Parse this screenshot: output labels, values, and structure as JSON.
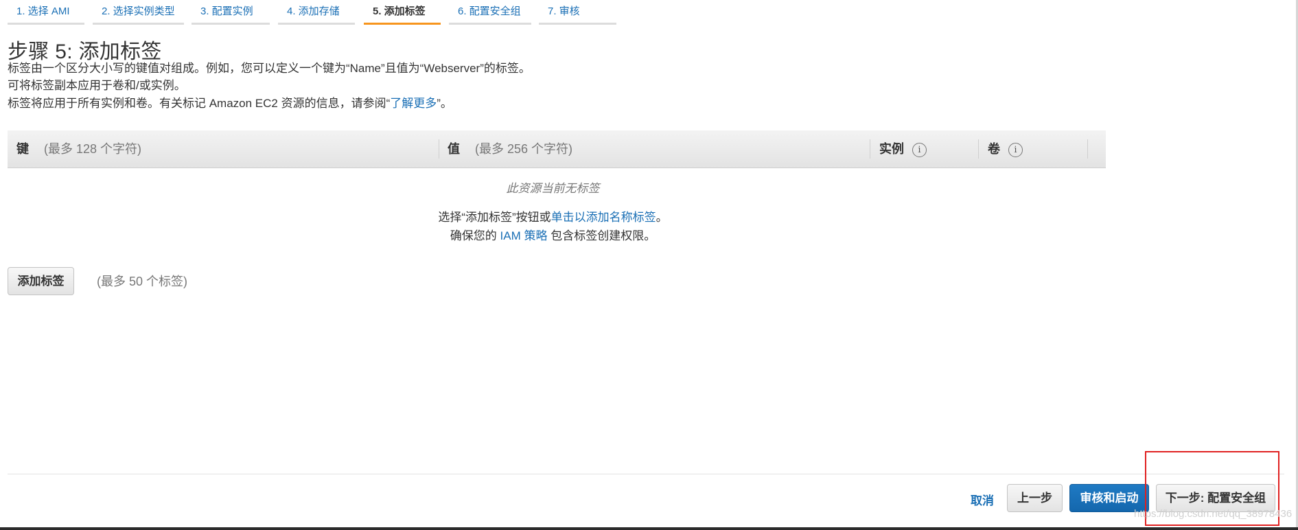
{
  "wizard": {
    "steps": [
      {
        "label": "1. 选择 AMI"
      },
      {
        "label": "2. 选择实例类型"
      },
      {
        "label": "3. 配置实例"
      },
      {
        "label": "4. 添加存储"
      },
      {
        "label": "5. 添加标签",
        "active": true
      },
      {
        "label": "6. 配置安全组"
      },
      {
        "label": "7. 审核"
      }
    ],
    "active_color": "#f7951d"
  },
  "page": {
    "title": "步骤 5: 添加标签",
    "desc_line1": "标签由一个区分大小写的键值对组成。例如，您可以定义一个键为“Name”且值为“Webserver”的标签。",
    "desc_line2": "可将标签副本应用于卷和/或实例。",
    "desc_line3_prefix": "标签将应用于所有实例和卷。有关标记 Amazon EC2 资源的信息，请参阅“",
    "desc_line3_link": "了解更多",
    "desc_line3_suffix": "”。"
  },
  "table": {
    "key_label": "键",
    "key_hint": "(最多 128 个字符)",
    "value_label": "值",
    "value_hint": "(最多 256 个字符)",
    "instances_label": "实例",
    "volumes_label": "卷",
    "info_glyph": "i",
    "empty_text": "此资源当前无标签",
    "choose_prefix": "选择“添加标签”按钮或",
    "choose_link": "单击以添加名称标签",
    "choose_suffix": "。",
    "ensure_prefix": "确保您的",
    "ensure_link": "IAM 策略",
    "ensure_suffix": "包含标签创建权限。"
  },
  "actions": {
    "add_tag": "添加标签",
    "max_tags": "(最多 50 个标签)"
  },
  "footer": {
    "cancel": "取消",
    "previous": "上一步",
    "review_launch": "审核和启动",
    "next": "下一步: 配置安全组"
  },
  "watermark": "https://blog.csdn.net/qq_38978436",
  "colors": {
    "link": "#1a6fb5",
    "primary": "#1467ad",
    "highlight": "#e02020"
  }
}
